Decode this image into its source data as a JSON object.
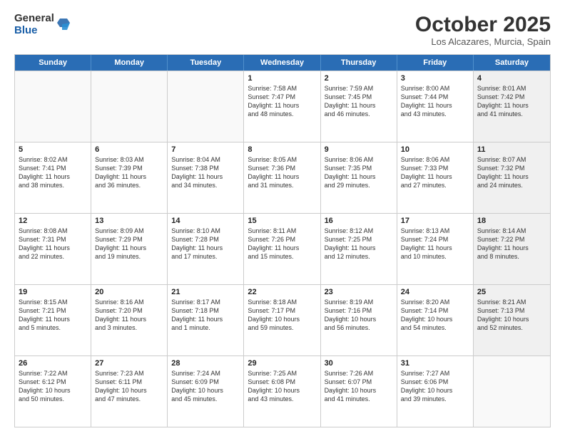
{
  "logo": {
    "general": "General",
    "blue": "Blue"
  },
  "header": {
    "month": "October 2025",
    "location": "Los Alcazares, Murcia, Spain"
  },
  "weekdays": [
    "Sunday",
    "Monday",
    "Tuesday",
    "Wednesday",
    "Thursday",
    "Friday",
    "Saturday"
  ],
  "rows": [
    [
      {
        "day": "",
        "text": "",
        "shaded": false,
        "empty": true
      },
      {
        "day": "",
        "text": "",
        "shaded": false,
        "empty": true
      },
      {
        "day": "",
        "text": "",
        "shaded": false,
        "empty": true
      },
      {
        "day": "1",
        "text": "Sunrise: 7:58 AM\nSunset: 7:47 PM\nDaylight: 11 hours\nand 48 minutes.",
        "shaded": false,
        "empty": false
      },
      {
        "day": "2",
        "text": "Sunrise: 7:59 AM\nSunset: 7:45 PM\nDaylight: 11 hours\nand 46 minutes.",
        "shaded": false,
        "empty": false
      },
      {
        "day": "3",
        "text": "Sunrise: 8:00 AM\nSunset: 7:44 PM\nDaylight: 11 hours\nand 43 minutes.",
        "shaded": false,
        "empty": false
      },
      {
        "day": "4",
        "text": "Sunrise: 8:01 AM\nSunset: 7:42 PM\nDaylight: 11 hours\nand 41 minutes.",
        "shaded": true,
        "empty": false
      }
    ],
    [
      {
        "day": "5",
        "text": "Sunrise: 8:02 AM\nSunset: 7:41 PM\nDaylight: 11 hours\nand 38 minutes.",
        "shaded": false,
        "empty": false
      },
      {
        "day": "6",
        "text": "Sunrise: 8:03 AM\nSunset: 7:39 PM\nDaylight: 11 hours\nand 36 minutes.",
        "shaded": false,
        "empty": false
      },
      {
        "day": "7",
        "text": "Sunrise: 8:04 AM\nSunset: 7:38 PM\nDaylight: 11 hours\nand 34 minutes.",
        "shaded": false,
        "empty": false
      },
      {
        "day": "8",
        "text": "Sunrise: 8:05 AM\nSunset: 7:36 PM\nDaylight: 11 hours\nand 31 minutes.",
        "shaded": false,
        "empty": false
      },
      {
        "day": "9",
        "text": "Sunrise: 8:06 AM\nSunset: 7:35 PM\nDaylight: 11 hours\nand 29 minutes.",
        "shaded": false,
        "empty": false
      },
      {
        "day": "10",
        "text": "Sunrise: 8:06 AM\nSunset: 7:33 PM\nDaylight: 11 hours\nand 27 minutes.",
        "shaded": false,
        "empty": false
      },
      {
        "day": "11",
        "text": "Sunrise: 8:07 AM\nSunset: 7:32 PM\nDaylight: 11 hours\nand 24 minutes.",
        "shaded": true,
        "empty": false
      }
    ],
    [
      {
        "day": "12",
        "text": "Sunrise: 8:08 AM\nSunset: 7:31 PM\nDaylight: 11 hours\nand 22 minutes.",
        "shaded": false,
        "empty": false
      },
      {
        "day": "13",
        "text": "Sunrise: 8:09 AM\nSunset: 7:29 PM\nDaylight: 11 hours\nand 19 minutes.",
        "shaded": false,
        "empty": false
      },
      {
        "day": "14",
        "text": "Sunrise: 8:10 AM\nSunset: 7:28 PM\nDaylight: 11 hours\nand 17 minutes.",
        "shaded": false,
        "empty": false
      },
      {
        "day": "15",
        "text": "Sunrise: 8:11 AM\nSunset: 7:26 PM\nDaylight: 11 hours\nand 15 minutes.",
        "shaded": false,
        "empty": false
      },
      {
        "day": "16",
        "text": "Sunrise: 8:12 AM\nSunset: 7:25 PM\nDaylight: 11 hours\nand 12 minutes.",
        "shaded": false,
        "empty": false
      },
      {
        "day": "17",
        "text": "Sunrise: 8:13 AM\nSunset: 7:24 PM\nDaylight: 11 hours\nand 10 minutes.",
        "shaded": false,
        "empty": false
      },
      {
        "day": "18",
        "text": "Sunrise: 8:14 AM\nSunset: 7:22 PM\nDaylight: 11 hours\nand 8 minutes.",
        "shaded": true,
        "empty": false
      }
    ],
    [
      {
        "day": "19",
        "text": "Sunrise: 8:15 AM\nSunset: 7:21 PM\nDaylight: 11 hours\nand 5 minutes.",
        "shaded": false,
        "empty": false
      },
      {
        "day": "20",
        "text": "Sunrise: 8:16 AM\nSunset: 7:20 PM\nDaylight: 11 hours\nand 3 minutes.",
        "shaded": false,
        "empty": false
      },
      {
        "day": "21",
        "text": "Sunrise: 8:17 AM\nSunset: 7:18 PM\nDaylight: 11 hours\nand 1 minute.",
        "shaded": false,
        "empty": false
      },
      {
        "day": "22",
        "text": "Sunrise: 8:18 AM\nSunset: 7:17 PM\nDaylight: 10 hours\nand 59 minutes.",
        "shaded": false,
        "empty": false
      },
      {
        "day": "23",
        "text": "Sunrise: 8:19 AM\nSunset: 7:16 PM\nDaylight: 10 hours\nand 56 minutes.",
        "shaded": false,
        "empty": false
      },
      {
        "day": "24",
        "text": "Sunrise: 8:20 AM\nSunset: 7:14 PM\nDaylight: 10 hours\nand 54 minutes.",
        "shaded": false,
        "empty": false
      },
      {
        "day": "25",
        "text": "Sunrise: 8:21 AM\nSunset: 7:13 PM\nDaylight: 10 hours\nand 52 minutes.",
        "shaded": true,
        "empty": false
      }
    ],
    [
      {
        "day": "26",
        "text": "Sunrise: 7:22 AM\nSunset: 6:12 PM\nDaylight: 10 hours\nand 50 minutes.",
        "shaded": false,
        "empty": false
      },
      {
        "day": "27",
        "text": "Sunrise: 7:23 AM\nSunset: 6:11 PM\nDaylight: 10 hours\nand 47 minutes.",
        "shaded": false,
        "empty": false
      },
      {
        "day": "28",
        "text": "Sunrise: 7:24 AM\nSunset: 6:09 PM\nDaylight: 10 hours\nand 45 minutes.",
        "shaded": false,
        "empty": false
      },
      {
        "day": "29",
        "text": "Sunrise: 7:25 AM\nSunset: 6:08 PM\nDaylight: 10 hours\nand 43 minutes.",
        "shaded": false,
        "empty": false
      },
      {
        "day": "30",
        "text": "Sunrise: 7:26 AM\nSunset: 6:07 PM\nDaylight: 10 hours\nand 41 minutes.",
        "shaded": false,
        "empty": false
      },
      {
        "day": "31",
        "text": "Sunrise: 7:27 AM\nSunset: 6:06 PM\nDaylight: 10 hours\nand 39 minutes.",
        "shaded": false,
        "empty": false
      },
      {
        "day": "",
        "text": "",
        "shaded": true,
        "empty": true
      }
    ]
  ]
}
